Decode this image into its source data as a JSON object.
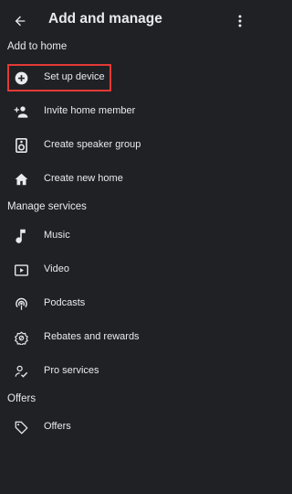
{
  "header": {
    "back_icon": "arrow-back-icon",
    "title": "Add and manage",
    "more_icon": "more-vert-icon"
  },
  "sections": [
    {
      "title": "Add to home",
      "items": [
        {
          "label": "Set up device",
          "icon": "add-circle-icon",
          "highlighted": true
        },
        {
          "label": "Invite home member",
          "icon": "person-add-icon"
        },
        {
          "label": "Create speaker group",
          "icon": "speaker-icon"
        },
        {
          "label": "Create new home",
          "icon": "home-icon"
        }
      ]
    },
    {
      "title": "Manage services",
      "items": [
        {
          "label": "Music",
          "icon": "music-note-icon"
        },
        {
          "label": "Video",
          "icon": "video-icon"
        },
        {
          "label": "Podcasts",
          "icon": "podcasts-icon"
        },
        {
          "label": "Rebates and rewards",
          "icon": "rebates-icon"
        },
        {
          "label": "Pro services",
          "icon": "pro-services-icon"
        }
      ]
    },
    {
      "title": "Offers",
      "items": [
        {
          "label": "Offers",
          "icon": "tag-icon"
        }
      ]
    }
  ],
  "colors": {
    "background": "#202124",
    "text": "#e8eaed",
    "highlight": "#e33a36"
  }
}
